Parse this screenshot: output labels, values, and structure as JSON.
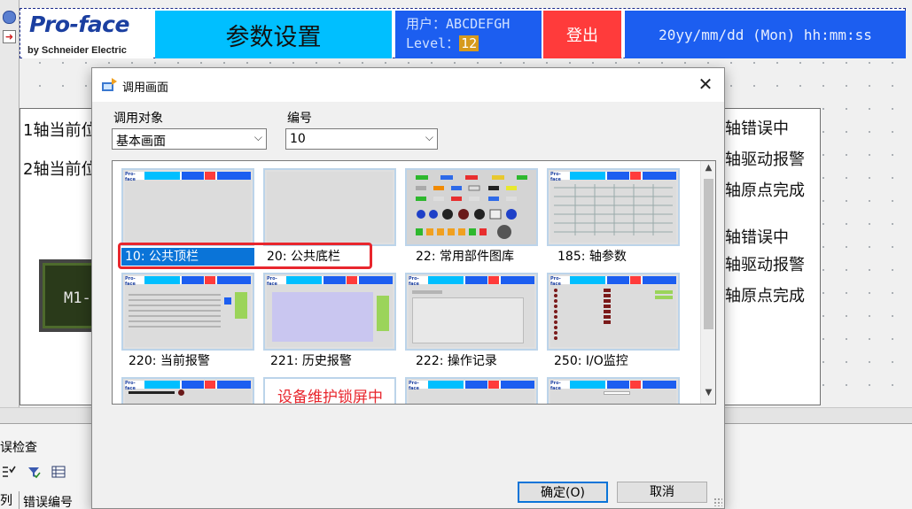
{
  "background": {
    "header": {
      "logo_text": "Pro-face",
      "logo_subtext": "by Schneider Electric",
      "title": "参数设置",
      "user_label": "用户：",
      "user_name": "ABCDEFGH",
      "level_label": "Level：",
      "level_value": "12",
      "logout_label": "登出",
      "datetime": "20yy/mm/dd (Mon) hh:mm:ss"
    },
    "left_labels": [
      "1轴当前位",
      "2轴当前位"
    ],
    "right_labels": [
      "轴错误中",
      "轴驱动报警",
      "轴原点完成",
      "轴错误中",
      "轴驱动报警",
      "轴原点完成"
    ],
    "m1_text": "M1-",
    "bottom_panel": {
      "title": "误检查",
      "column_1": "列",
      "column_2": "错误编号"
    },
    "colors": {
      "title_bg": "#00bfff",
      "user_bg": "#1c5ef0",
      "logout_bg": "#ff3b3b",
      "level_bg": "#d69a1e"
    }
  },
  "dialog": {
    "title": "调用画面",
    "close_glyph": "✕",
    "target_label": "调用对象",
    "target_value": "基本画面",
    "number_label": "编号",
    "number_value": "10",
    "thumbnails": [
      {
        "caption": "10: 公共顶栏",
        "selected": true,
        "style": "header"
      },
      {
        "caption": "20: 公共底栏",
        "selected": false,
        "style": "blank"
      },
      {
        "caption": "22: 常用部件图库",
        "selected": false,
        "style": "parts"
      },
      {
        "caption": "185: 轴参数",
        "selected": false,
        "style": "table"
      },
      {
        "caption": "220: 当前报警",
        "selected": false,
        "style": "alarm"
      },
      {
        "caption": "221: 历史报警",
        "selected": false,
        "style": "history"
      },
      {
        "caption": "222: 操作记录",
        "selected": false,
        "style": "oplog"
      },
      {
        "caption": "250: I/O监控",
        "selected": false,
        "style": "io"
      },
      {
        "caption": "",
        "selected": false,
        "style": "partial"
      },
      {
        "caption": "",
        "selected": false,
        "style": "maint"
      },
      {
        "caption": "",
        "selected": false,
        "style": "partial"
      },
      {
        "caption": "",
        "selected": false,
        "style": "partial"
      }
    ],
    "maint_text": "设备维护锁屏中",
    "ok_label": "确定(O)",
    "cancel_label": "取消",
    "accent_color": "#0a74d8",
    "highlight_color": "#e8262d"
  }
}
